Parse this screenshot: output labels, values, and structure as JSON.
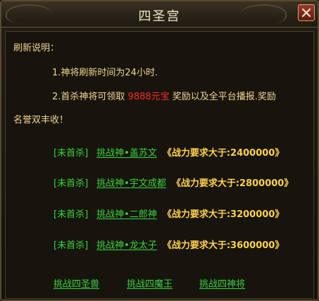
{
  "window": {
    "title": "四圣宫",
    "close_icon": "close-x-icon"
  },
  "description": {
    "heading": "刷新说明：",
    "line1": "1.神将刷新时间为24小时.",
    "line2_before": "2.首杀神将可领取 ",
    "line2_highlight": "9888元宝",
    "line2_after": " 奖励以及全平台播报.奖励",
    "line3": "名誉双丰收！"
  },
  "challenges": [
    {
      "tag": "[未首杀]",
      "link": "挑战神•盖苏文",
      "requirement": "《战力要求大于:2400000》"
    },
    {
      "tag": "[未首杀]",
      "link": "挑战神•宇文成都",
      "requirement": "《战力要求大于:2800000》"
    },
    {
      "tag": "[未首杀]",
      "link": "挑战神•二郎神",
      "requirement": "《战力要求大于:3200000》"
    },
    {
      "tag": "[未首杀]",
      "link": "挑战神•龙太子",
      "requirement": "《战力要求大于:3600000》"
    }
  ],
  "bottom_links": [
    "挑战四圣兽",
    "挑战四魔王",
    "挑战四神将"
  ],
  "colors": {
    "accent_gold": "#f2d58e",
    "link_green": "#39d43b",
    "requirement_yellow": "#ffd24a",
    "highlight_red": "#ff2a1f"
  }
}
